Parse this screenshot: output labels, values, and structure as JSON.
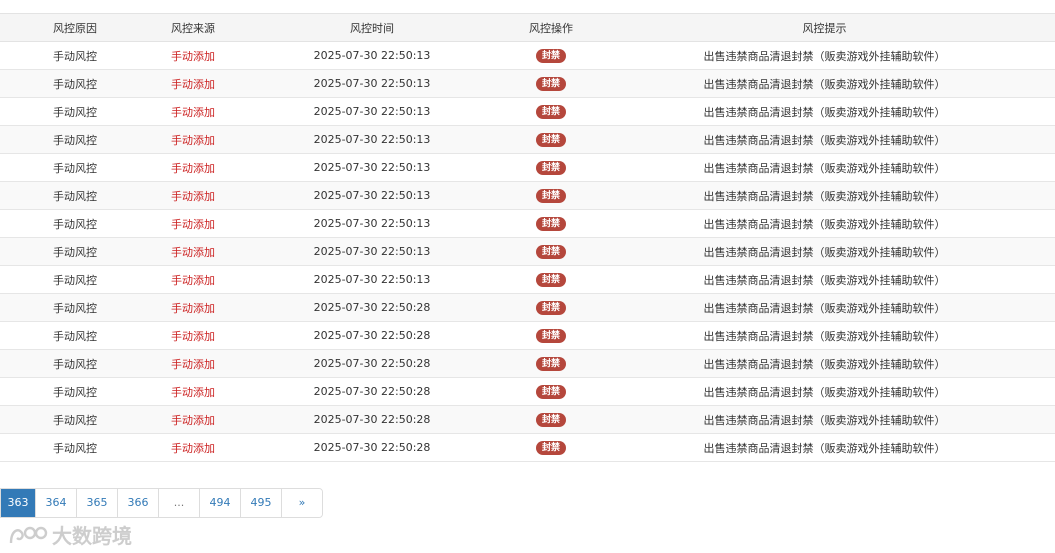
{
  "table": {
    "headers": [
      "风控原因",
      "风控来源",
      "风控时间",
      "风控操作",
      "风控提示"
    ],
    "rows": [
      {
        "reason": "手动风控",
        "source": "手动添加",
        "time": "2025-07-30 22:50:13",
        "action": "封禁",
        "tip": "出售违禁商品清退封禁（贩卖游戏外挂辅助软件）"
      },
      {
        "reason": "手动风控",
        "source": "手动添加",
        "time": "2025-07-30 22:50:13",
        "action": "封禁",
        "tip": "出售违禁商品清退封禁（贩卖游戏外挂辅助软件）"
      },
      {
        "reason": "手动风控",
        "source": "手动添加",
        "time": "2025-07-30 22:50:13",
        "action": "封禁",
        "tip": "出售违禁商品清退封禁（贩卖游戏外挂辅助软件）"
      },
      {
        "reason": "手动风控",
        "source": "手动添加",
        "time": "2025-07-30 22:50:13",
        "action": "封禁",
        "tip": "出售违禁商品清退封禁（贩卖游戏外挂辅助软件）"
      },
      {
        "reason": "手动风控",
        "source": "手动添加",
        "time": "2025-07-30 22:50:13",
        "action": "封禁",
        "tip": "出售违禁商品清退封禁（贩卖游戏外挂辅助软件）"
      },
      {
        "reason": "手动风控",
        "source": "手动添加",
        "time": "2025-07-30 22:50:13",
        "action": "封禁",
        "tip": "出售违禁商品清退封禁（贩卖游戏外挂辅助软件）"
      },
      {
        "reason": "手动风控",
        "source": "手动添加",
        "time": "2025-07-30 22:50:13",
        "action": "封禁",
        "tip": "出售违禁商品清退封禁（贩卖游戏外挂辅助软件）"
      },
      {
        "reason": "手动风控",
        "source": "手动添加",
        "time": "2025-07-30 22:50:13",
        "action": "封禁",
        "tip": "出售违禁商品清退封禁（贩卖游戏外挂辅助软件）"
      },
      {
        "reason": "手动风控",
        "source": "手动添加",
        "time": "2025-07-30 22:50:13",
        "action": "封禁",
        "tip": "出售违禁商品清退封禁（贩卖游戏外挂辅助软件）"
      },
      {
        "reason": "手动风控",
        "source": "手动添加",
        "time": "2025-07-30 22:50:28",
        "action": "封禁",
        "tip": "出售违禁商品清退封禁（贩卖游戏外挂辅助软件）"
      },
      {
        "reason": "手动风控",
        "source": "手动添加",
        "time": "2025-07-30 22:50:28",
        "action": "封禁",
        "tip": "出售违禁商品清退封禁（贩卖游戏外挂辅助软件）"
      },
      {
        "reason": "手动风控",
        "source": "手动添加",
        "time": "2025-07-30 22:50:28",
        "action": "封禁",
        "tip": "出售违禁商品清退封禁（贩卖游戏外挂辅助软件）"
      },
      {
        "reason": "手动风控",
        "source": "手动添加",
        "time": "2025-07-30 22:50:28",
        "action": "封禁",
        "tip": "出售违禁商品清退封禁（贩卖游戏外挂辅助软件）"
      },
      {
        "reason": "手动风控",
        "source": "手动添加",
        "time": "2025-07-30 22:50:28",
        "action": "封禁",
        "tip": "出售违禁商品清退封禁（贩卖游戏外挂辅助软件）"
      },
      {
        "reason": "手动风控",
        "source": "手动添加",
        "time": "2025-07-30 22:50:28",
        "action": "封禁",
        "tip": "出售违禁商品清退封禁（贩卖游戏外挂辅助软件）"
      }
    ]
  },
  "pagination": {
    "current": "363",
    "pages": [
      "363",
      "364",
      "365",
      "366",
      "...",
      "494",
      "495",
      "»"
    ]
  },
  "watermark": {
    "text": "大数跨境",
    "icon": "brand-logo-icon"
  },
  "colors": {
    "badge": "#b5473c",
    "source_text": "#cc2222",
    "pagination_active": "#337ab7",
    "link": "#337ab7"
  }
}
